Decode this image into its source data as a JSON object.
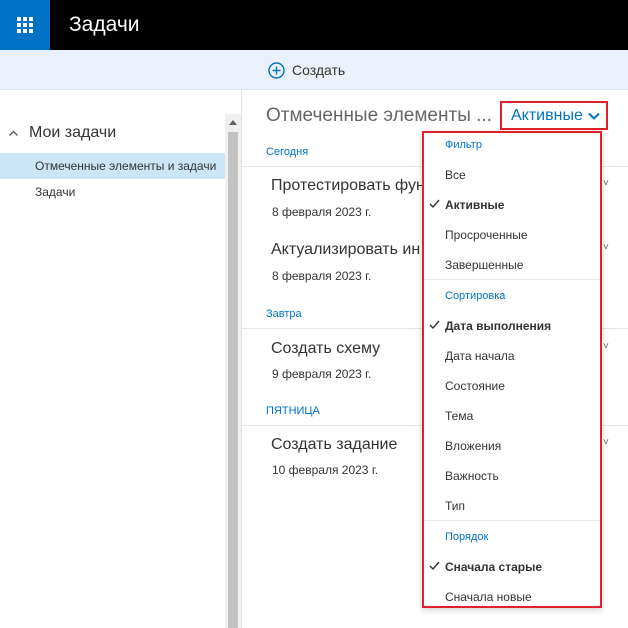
{
  "app": {
    "title": "Задачи",
    "waffle_icon": "app-launcher-icon"
  },
  "toolbar": {
    "create_label": "Создать"
  },
  "sidebar": {
    "group_label": "Мои задачи",
    "items": [
      {
        "label": "Отмеченные элементы и задачи",
        "selected": true
      },
      {
        "label": "Задачи",
        "selected": false
      }
    ]
  },
  "list": {
    "title": "Отмеченные элементы ...",
    "filter_label": "Активные",
    "sections": [
      {
        "label": "Сегодня",
        "tasks": [
          {
            "title": "Протестировать фун",
            "date": "8 февраля 2023 г."
          },
          {
            "title": "Актуализировать ин",
            "date": "8 февраля 2023 г."
          }
        ]
      },
      {
        "label": "Завтра",
        "tasks": [
          {
            "title": "Создать схему",
            "date": "9 февраля 2023 г."
          }
        ]
      },
      {
        "label": "ПЯТНИЦА",
        "tasks": [
          {
            "title": "Создать задание",
            "date": "10 февраля 2023 г."
          }
        ]
      }
    ]
  },
  "dropdown": {
    "filter_header": "Фильтр",
    "filter_items": [
      {
        "label": "Все",
        "checked": false
      },
      {
        "label": "Активные",
        "checked": true
      },
      {
        "label": "Просроченные",
        "checked": false
      },
      {
        "label": "Завершенные",
        "checked": false
      }
    ],
    "sort_header": "Сортировка",
    "sort_items": [
      {
        "label": "Дата выполнения",
        "checked": true
      },
      {
        "label": "Дата начала",
        "checked": false
      },
      {
        "label": "Состояние",
        "checked": false
      },
      {
        "label": "Тема",
        "checked": false
      },
      {
        "label": "Вложения",
        "checked": false
      },
      {
        "label": "Важность",
        "checked": false
      },
      {
        "label": "Тип",
        "checked": false
      }
    ],
    "order_header": "Порядок",
    "order_items": [
      {
        "label": "Сначала старые",
        "checked": true
      },
      {
        "label": "Сначала новые",
        "checked": false
      }
    ]
  },
  "colors": {
    "accent": "#0072c6",
    "highlight_border": "#e0202a",
    "selected_bg": "#cde6f7",
    "command_bar_bg": "#eaf1fa"
  }
}
